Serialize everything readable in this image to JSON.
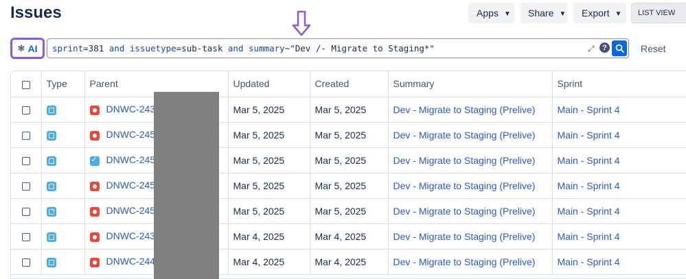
{
  "page": {
    "title": "Issues"
  },
  "header_buttons": {
    "apps": "Apps",
    "share": "Share",
    "export": "Export",
    "list_view": "LIST VIEW"
  },
  "search": {
    "ai_label": "AI",
    "query_parts": [
      {
        "t": "sprint",
        "k": "kw"
      },
      {
        "t": "=381 ",
        "k": "val"
      },
      {
        "t": "and",
        "k": "kw"
      },
      {
        "t": " ",
        "k": "val"
      },
      {
        "t": "issuetype",
        "k": "kw"
      },
      {
        "t": "=sub-task ",
        "k": "val"
      },
      {
        "t": "and",
        "k": "kw"
      },
      {
        "t": " ",
        "k": "val"
      },
      {
        "t": "summary",
        "k": "kw"
      },
      {
        "t": "~\"Dev /- Migrate to Staging*\"",
        "k": "str"
      }
    ],
    "help_glyph": "?",
    "reset_label": "Reset"
  },
  "table": {
    "columns": [
      "Type",
      "Parent",
      "Updated",
      "Created",
      "Summary",
      "Sprint"
    ],
    "rows": [
      {
        "parent_type": "bug",
        "parent": "DNWC-2432",
        "updated": "Mar 5, 2025",
        "created": "Mar 5, 2025",
        "summary": "Dev - Migrate to Staging (Prelive)",
        "sprint": "Main - Sprint 4"
      },
      {
        "parent_type": "bug",
        "parent": "DNWC-2457",
        "updated": "Mar 5, 2025",
        "created": "Mar 5, 2025",
        "summary": "Dev - Migrate to Staging (Prelive)",
        "sprint": "Main - Sprint 4"
      },
      {
        "parent_type": "task",
        "parent": "DNWC-2455",
        "updated": "Mar 5, 2025",
        "created": "Mar 5, 2025",
        "summary": "Dev - Migrate to Staging (Prelive)",
        "sprint": "Main - Sprint 4"
      },
      {
        "parent_type": "bug",
        "parent": "DNWC-2452",
        "updated": "Mar 5, 2025",
        "created": "Mar 5, 2025",
        "summary": "Dev - Migrate to Staging (Prelive)",
        "sprint": "Main - Sprint 4"
      },
      {
        "parent_type": "bug",
        "parent": "DNWC-2451",
        "updated": "Mar 5, 2025",
        "created": "Mar 5, 2025",
        "summary": "Dev - Migrate to Staging (Prelive)",
        "sprint": "Main - Sprint 4"
      },
      {
        "parent_type": "bug",
        "parent": "DNWC-2439",
        "updated": "Mar 4, 2025",
        "created": "Mar 4, 2025",
        "summary": "Dev - Migrate to Staging (Prelive)",
        "sprint": "Main - Sprint 4"
      },
      {
        "parent_type": "bug",
        "parent": "DNWC-2447",
        "updated": "Mar 4, 2025",
        "created": "Mar 4, 2025",
        "summary": "Dev - Migrate to Staging (Prelive)",
        "sprint": "Main - Sprint 4"
      }
    ]
  },
  "colors": {
    "accent": "#0c66e4",
    "annotation_arrow": "#8f57dd",
    "bug": "#e5493a",
    "subtask": "#4bade8"
  }
}
